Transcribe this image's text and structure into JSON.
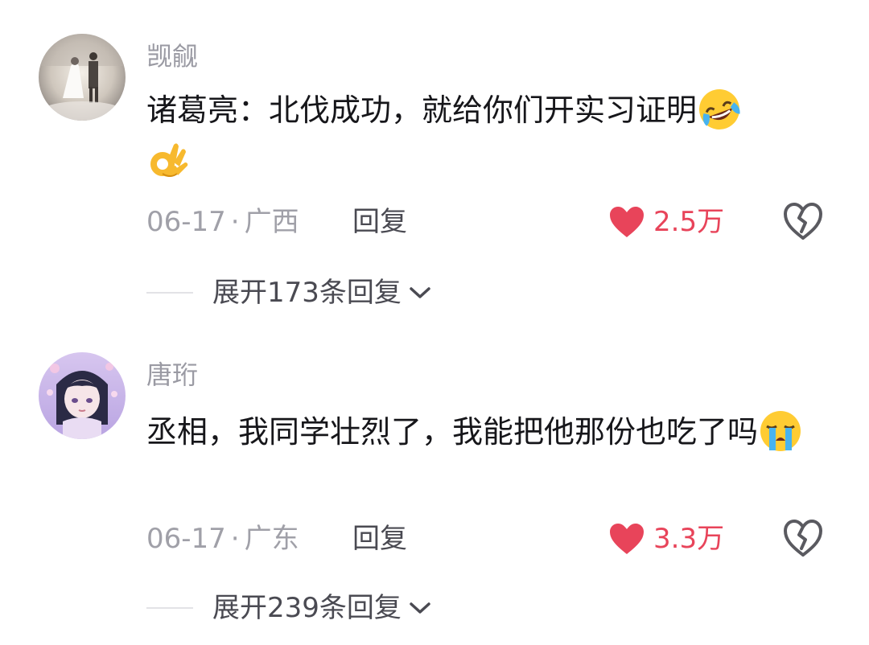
{
  "comments": [
    {
      "username": "觊觎",
      "text": "诸葛亮：北伐成功，就给你们开实习证明",
      "text_emoji_1": "rolling-on-floor-laughing-emoji",
      "text_emoji_2": "ok-hand-emoji",
      "date": "06-17",
      "separator": "·",
      "location": "广西",
      "reply_label": "回复",
      "likes": "2.5万",
      "expand_label": "展开173条回复"
    },
    {
      "username": "唐珩",
      "text": "丞相，我同学壮烈了，我能把他那份也吃了吗",
      "text_emoji_1": "loudly-crying-face-emoji",
      "date": "06-17",
      "separator": "·",
      "location": "广东",
      "reply_label": "回复",
      "likes": "3.3万",
      "expand_label": "展开239条回复"
    }
  ],
  "colors": {
    "like_red": "#e8445a",
    "username_gray": "#9a9aa3",
    "text_dark": "#16161a",
    "meta_gray": "#a0a0a8"
  }
}
